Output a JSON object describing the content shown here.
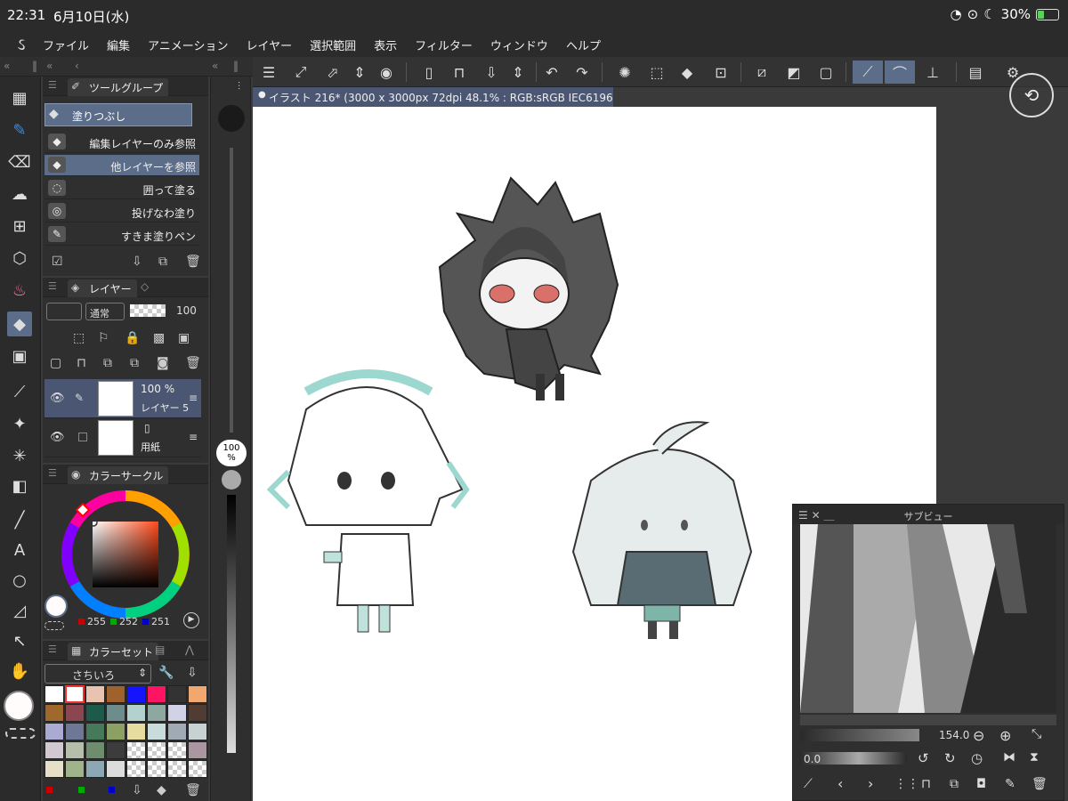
{
  "status_bar": {
    "time": "22:31",
    "date": "6月10日(水)",
    "battery": "30%"
  },
  "menu": {
    "items": [
      "ファイル",
      "編集",
      "アニメーション",
      "レイヤー",
      "選択範囲",
      "表示",
      "フィルター",
      "ウィンドウ",
      "ヘルプ"
    ]
  },
  "document": {
    "tab_title": "イラスト 216* (3000 x 3000px 72dpi 48.1% : RGB:sRGB IEC61966-2.1)"
  },
  "tool_group": {
    "title": "ツールグループ",
    "current": "塗りつぶし",
    "subtools": [
      {
        "label": "編集レイヤーのみ参照",
        "selected": false
      },
      {
        "label": "他レイヤーを参照",
        "selected": true
      },
      {
        "label": "囲って塗る",
        "selected": false
      },
      {
        "label": "投げなわ塗り",
        "selected": false
      },
      {
        "label": "すきま塗りペン",
        "selected": false
      }
    ]
  },
  "layer_panel": {
    "tab_label": "レイヤー",
    "blend_mode": "通常",
    "opacity": "100",
    "layers": [
      {
        "opacity": "100 %",
        "name": "レイヤー 5",
        "selected": true
      },
      {
        "opacity": "",
        "name": "用紙",
        "selected": false
      }
    ]
  },
  "color_panel": {
    "title": "カラーサークル",
    "rgb": {
      "r": "255",
      "g": "252",
      "b": "251"
    }
  },
  "color_set": {
    "title": "カラーセット",
    "set_name": "さちいろ",
    "swatches": [
      "#ffffff",
      "#ffffff",
      "#e8c4b0",
      "#a0622d",
      "#1414ff",
      "#ff1464",
      "#333333",
      "#f0a870",
      "#a0682d",
      "#8c4650",
      "#1e5a4b",
      "#6e8c8c",
      "#b4d2cd",
      "#8ca8a0",
      "#d2d2e6",
      "#503c32",
      "#aaaad2",
      "#6e7896",
      "#46785a",
      "#8ca064",
      "#e6dca0",
      "#c8dcdc",
      "#a0aab4",
      "#c8d2d2",
      "#d2c8d2",
      "#b4beaa",
      "#6e8c6e",
      "#3c3c3c",
      "checker",
      "checker",
      "checker",
      "#aa96a0",
      "#e6e0c8",
      "#a0b48c",
      "#8ca8b4",
      "#dcdcdc",
      "checker",
      "checker",
      "checker",
      "checker"
    ]
  },
  "slider": {
    "zoom_label": "100\n%"
  },
  "subview": {
    "title": "サブビュー",
    "zoom": "154.0",
    "angle": "0.0"
  },
  "colors": {
    "accent": "#5c6d8a",
    "panel_bg": "#2f2f2f",
    "toolbar_bg": "#333333",
    "main_color": "#fffcfb"
  }
}
